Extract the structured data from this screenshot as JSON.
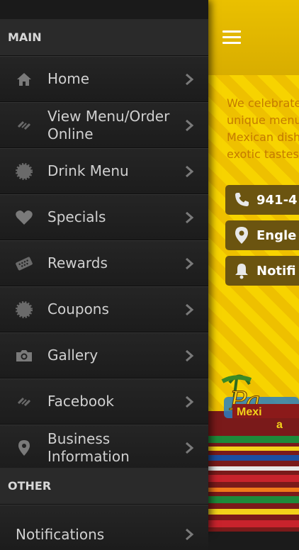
{
  "menu": {
    "section_main": "MAIN",
    "section_other": "OTHER",
    "items": [
      {
        "label": "Home",
        "icon": "home-icon"
      },
      {
        "label": "View Menu/Order Online",
        "icon": "link-icon"
      },
      {
        "label": "Drink Menu",
        "icon": "badge-icon"
      },
      {
        "label": "Specials",
        "icon": "heart-icon"
      },
      {
        "label": "Rewards",
        "icon": "ticket-icon"
      },
      {
        "label": "Coupons",
        "icon": "badge-icon"
      },
      {
        "label": "Gallery",
        "icon": "camera-icon"
      },
      {
        "label": "Facebook",
        "icon": "link-icon"
      },
      {
        "label": "Business Information",
        "icon": "location-pin-icon"
      }
    ],
    "other_items": [
      {
        "label": "Notifications"
      }
    ]
  },
  "content": {
    "blurb_lines": [
      "We celebrate",
      "unique menu",
      "Mexican dish",
      "exotic tastes"
    ],
    "buttons": [
      {
        "label": "941-4",
        "icon": "phone-icon"
      },
      {
        "label": "Engle",
        "icon": "location-pin-icon"
      },
      {
        "label": "Notifi",
        "icon": "bell-icon"
      }
    ],
    "logo_text": [
      "Pa",
      "Mexi",
      "a"
    ]
  },
  "colors": {
    "accent_yellow": "#f2c500",
    "pill_brown": "#6b5410",
    "menu_bg": "#1e1e1e"
  }
}
